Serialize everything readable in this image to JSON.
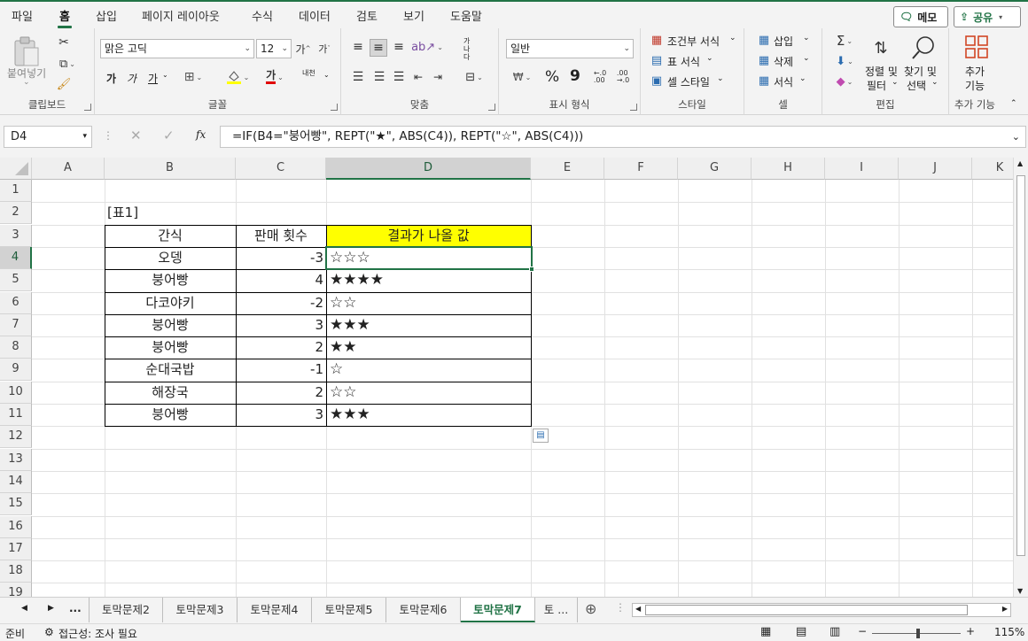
{
  "ribbon_tabs": [
    "파일",
    "홈",
    "삽입",
    "페이지 레이아웃",
    "수식",
    "데이터",
    "검토",
    "보기",
    "도움말"
  ],
  "active_tab": "홈",
  "top_buttons": {
    "comment": "메모",
    "share": "공유"
  },
  "ribbon": {
    "clipboard": {
      "paste": "붙여넣기",
      "label": "클립보드"
    },
    "font": {
      "name": "맑은 고딕",
      "size": "12",
      "bold": "가",
      "italic": "가",
      "underline": "가",
      "label": "글꼴",
      "vert": "내천"
    },
    "align": {
      "label": "맞춤",
      "wrap": "가나다"
    },
    "number": {
      "format": "일반",
      "percent": "%",
      "comma": "9",
      "label": "표시 형식"
    },
    "styles": {
      "cond": "조건부 서식",
      "table": "표 서식",
      "cell": "셀 스타일",
      "label": "스타일"
    },
    "cells": {
      "insert": "삽입",
      "delete": "삭제",
      "format": "서식",
      "label": "셀"
    },
    "editing": {
      "sort1": "정렬 및",
      "sort2": "필터",
      "find1": "찾기 및",
      "find2": "선택",
      "label": "편집"
    },
    "addins": {
      "btn1": "추가",
      "btn2": "기능",
      "label": "추가 기능"
    }
  },
  "formula_bar": {
    "name_box": "D4",
    "formula": "=IF(B4=\"붕어빵\", REPT(\"★\", ABS(C4)), REPT(\"☆\", ABS(C4)))"
  },
  "columns": [
    "A",
    "B",
    "C",
    "D",
    "E",
    "F",
    "G",
    "H",
    "I",
    "J",
    "K"
  ],
  "rows": [
    "1",
    "2",
    "3",
    "4",
    "5",
    "6",
    "7",
    "8",
    "9",
    "10",
    "11",
    "12",
    "13",
    "14",
    "15",
    "16",
    "17",
    "18",
    "19"
  ],
  "sheet": {
    "caption": "[표1]",
    "headers": [
      "간식",
      "판매 횟수",
      "결과가 나올 값"
    ],
    "data": [
      {
        "snack": "오뎅",
        "count": "-3",
        "result": "☆☆☆"
      },
      {
        "snack": "붕어빵",
        "count": "4",
        "result": "★★★★"
      },
      {
        "snack": "다코야키",
        "count": "-2",
        "result": "☆☆"
      },
      {
        "snack": "붕어빵",
        "count": "3",
        "result": "★★★"
      },
      {
        "snack": "붕어빵",
        "count": "2",
        "result": "★★"
      },
      {
        "snack": "순대국밥",
        "count": "-1",
        "result": "☆"
      },
      {
        "snack": "해장국",
        "count": "2",
        "result": "☆☆"
      },
      {
        "snack": "붕어빵",
        "count": "3",
        "result": "★★★"
      }
    ]
  },
  "sheet_tabs": [
    "토막문제2",
    "토막문제3",
    "토막문제4",
    "토막문제5",
    "토막문제6",
    "토막문제7",
    "토 ..."
  ],
  "active_sheet": "토막문제7",
  "status": {
    "ready": "준비",
    "accessibility": "접근성: 조사 필요",
    "zoom": "115%"
  },
  "colors": {
    "accent": "#217346",
    "header_fill": "#ffff00"
  }
}
